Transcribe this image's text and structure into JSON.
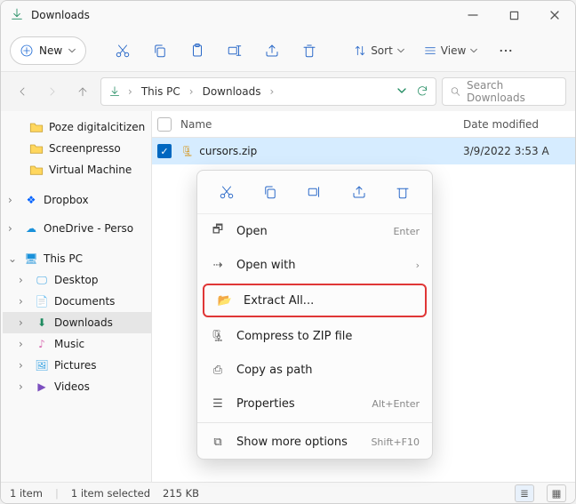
{
  "title": "Downloads",
  "toolbar": {
    "new": "New",
    "sort": "Sort",
    "view": "View"
  },
  "breadcrumb": {
    "root": "This PC",
    "current": "Downloads"
  },
  "search_placeholder": "Search Downloads",
  "columns": {
    "name": "Name",
    "date": "Date modified"
  },
  "file": {
    "name": "cursors.zip",
    "date": "3/9/2022 3:53 A"
  },
  "sidebar": {
    "poze": "Poze digitalcitizen",
    "screenpresso": "Screenpresso",
    "vm": "Virtual Machine",
    "dropbox": "Dropbox",
    "onedrive": "OneDrive - Perso",
    "thispc": "This PC",
    "desktop": "Desktop",
    "documents": "Documents",
    "downloads": "Downloads",
    "music": "Music",
    "pictures": "Pictures",
    "videos": "Videos"
  },
  "ctx": {
    "open": "Open",
    "open_hint": "Enter",
    "openwith": "Open with",
    "extract": "Extract All...",
    "compress": "Compress to ZIP file",
    "copypath": "Copy as path",
    "properties": "Properties",
    "properties_hint": "Alt+Enter",
    "more": "Show more options",
    "more_hint": "Shift+F10"
  },
  "status": {
    "count": "1 item",
    "selection": "1 item selected",
    "size": "215 KB"
  }
}
